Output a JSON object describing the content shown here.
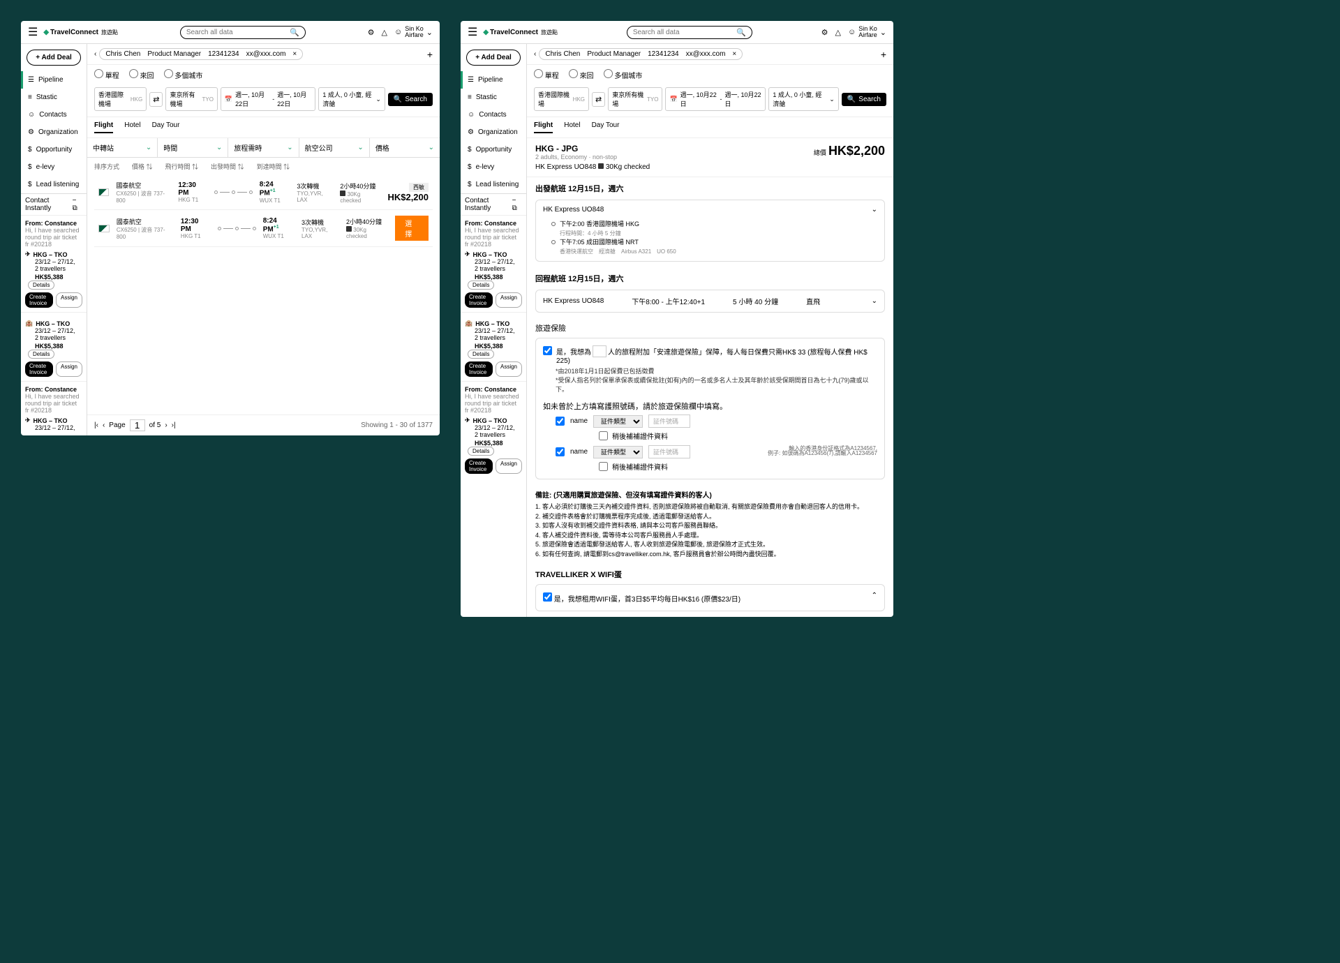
{
  "brand": {
    "name": "TravelConnect",
    "sub": "旅遊點"
  },
  "search_placeholder": "Search all data",
  "user": {
    "name": "Sin Ko",
    "role": "Airfare"
  },
  "add_deal": "Add Deal",
  "nav": [
    {
      "icon": "☰",
      "label": "Pipeline"
    },
    {
      "icon": "≡",
      "label": "Stastic"
    },
    {
      "icon": "☺",
      "label": "Contacts"
    },
    {
      "icon": "⚙",
      "label": "Organization"
    },
    {
      "icon": "$",
      "label": "Opportunity"
    },
    {
      "icon": "$",
      "label": "e-levy"
    },
    {
      "icon": "$",
      "label": "Lead listening"
    }
  ],
  "contact_header": "Contact Instantly",
  "cards": {
    "from": "From: Constance",
    "msg": "Hi, I have searched round trip air ticket fr #20218",
    "route": "HKG – TKO",
    "dates": "23/12 – 27/12,",
    "trav": "2 travellers",
    "price": "HK$5,388",
    "details": "Details",
    "invoice": "Create Invoice",
    "assign": "Assign"
  },
  "breadcrumb": {
    "name": "Chris Chen",
    "title": "Product Manager",
    "id": "12341234",
    "email": "xx@xxx.com"
  },
  "trip_types": [
    "單程",
    "來回",
    "多個城市"
  ],
  "search": {
    "from": "香港國際機場",
    "from_code": "HKG",
    "to": "東京所有機場",
    "to_code": "TYO",
    "date1": "週一, 10月22日",
    "date2": "週一, 10月22日",
    "pax": "1 成人, 0 小童, 經濟艙",
    "btn": "Search"
  },
  "tabs": [
    "Flight",
    "Hotel",
    "Day Tour"
  ],
  "filters": [
    "中轉站",
    "時間",
    "旅程需時",
    "航空公司",
    "價格"
  ],
  "sort": [
    "排序方式",
    "價格 ⇅",
    "飛行時間 ⇅",
    "出發時間 ⇅",
    "到達時間 ⇅"
  ],
  "flight": {
    "airline": "國泰航空",
    "flightno": "CX6250 | 波音 737-800",
    "dep_time": "12:30 PM",
    "dep_code": "HKG T1",
    "arr_time": "8:24 PM",
    "arr_plus": "+1",
    "arr_code": "WUX T1",
    "stops": "3次轉機",
    "via": "TYO,YVR, LAX",
    "dur": "2小時40分鐘",
    "bag": "30Kg checked",
    "tag": "西敏",
    "price": "HK$2,200",
    "select": "選擇"
  },
  "pagination": {
    "page_label": "Page",
    "page": "1",
    "of": "of 5",
    "summary": "Showing 1 - 30 of 1377"
  },
  "s2": {
    "route": "HKG - JPG",
    "sub": "2 adults, Economy · non-stop",
    "flight": "HK Express UO848",
    "bag": "30Kg checked",
    "total_label": "總價",
    "price": "HK$2,200",
    "depart_title": "出發航班 12月15日，週六",
    "seg_flight": "HK Express UO848",
    "stop1": "下午2:00 香港國際機場 HKG",
    "dur": "行程時間：4 小時 5 分鐘",
    "stop2": "下午7:05 成田國際機場 NRT",
    "meta": "香港快運航空　經濟艙　Airbus A321　UO 650",
    "return_title": "回程航班 12月15日，週六",
    "ret_time": "下午8:00 - 上午12:40+1",
    "ret_dur": "5 小時 40 分鐘",
    "ret_type": "直飛",
    "insurance_label": "旅遊保險",
    "ins1": "是，我想為",
    "ins1b": "人的旅程附加「安達旅遊保險」保障，每人每日保費只需HK$ 33 (旅程每人保費 HK$ 225)",
    "ins_note1": "*由2018年1月1日起保費已包括徵費",
    "ins_note2": "*受保人指名列於保單承保表或續保批註(如有)內的一名或多名人士及其年齡於該受保期間首日為七十九(79)歲或以下。",
    "ins_prompt": "如未曾於上方填寫護照號碼，請於旅遊保險欄中填寫。",
    "field_label": "name",
    "doc_type": "証件類型",
    "doc_num": "証件號碼",
    "later": "稍後補補證件資料",
    "hint1": "輸入的香港身份証格式為A1234567,",
    "hint2": "例子: 如號碼為A123456(7),請輸入A1234567",
    "notes_title": "備註: (只適用購買旅遊保險、但沒有填寫證件資料的客人)",
    "notes": [
      "1. 客人必須於訂購後三天內補交證件資料, 否則旅遊保險將被自動取消, 有關旅遊保險費用亦會自動退回客人的信用卡。",
      "2. 補交證件表格會於訂購機票程序完成後, 透過電郵發送給客人。",
      "3. 如客人沒有收到補交證件資料表格, 請與本公司客戶服務員聯絡。",
      "4. 客人補交證件資料後, 需等待本公司客戶服務員人手處理。",
      "5. 旅遊保險會透過電郵發送給客人, 客人收到旅遊保險電郵後, 旅遊保險才正式生效。",
      "6. 如有任何查詢, 請電郵到cs@travelliker.com.hk, 客戶服務員會於辦公時間內盡快回覆。"
    ],
    "wifi_title": "TRAVELLIKER X WIFI蛋",
    "wifi_opt": "是，我想租用WIFI蛋，首3日$5平均每日HK$16 (原價$23/日)"
  }
}
